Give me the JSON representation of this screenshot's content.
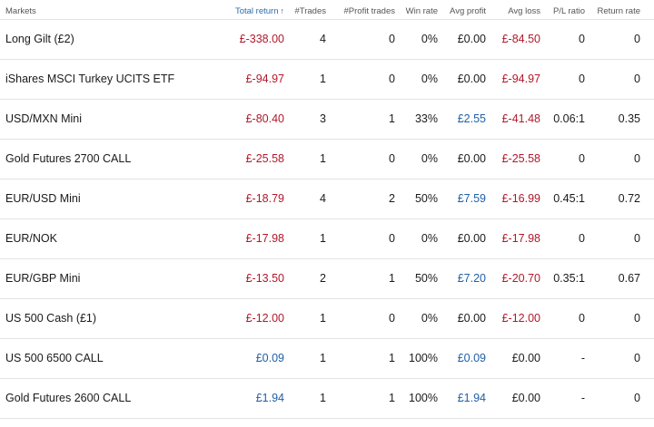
{
  "headers": {
    "markets": "Markets",
    "total_return": "Total return",
    "sort_indicator": "↑",
    "trades": "#Trades",
    "profit_trades": "#Profit trades",
    "win_rate": "Win rate",
    "avg_profit": "Avg profit",
    "avg_loss": "Avg loss",
    "pl_ratio": "P/L ratio",
    "return_rate": "Return rate"
  },
  "colors": {
    "negative": "#b2182b",
    "positive": "#1f5fa6",
    "sorted_header": "#2b6bb0"
  },
  "rows": [
    {
      "market": "Long Gilt (£2)",
      "total_return": "£-338.00",
      "total_sign": "neg",
      "trades": "4",
      "profit_trades": "0",
      "win_rate": "0%",
      "avg_profit": "£0.00",
      "avg_profit_sign": "neutral",
      "avg_loss": "£-84.50",
      "avg_loss_sign": "neg",
      "pl_ratio": "0",
      "return_rate": "0"
    },
    {
      "market": "iShares MSCI Turkey UCITS ETF",
      "total_return": "£-94.97",
      "total_sign": "neg",
      "trades": "1",
      "profit_trades": "0",
      "win_rate": "0%",
      "avg_profit": "£0.00",
      "avg_profit_sign": "neutral",
      "avg_loss": "£-94.97",
      "avg_loss_sign": "neg",
      "pl_ratio": "0",
      "return_rate": "0"
    },
    {
      "market": "USD/MXN Mini",
      "total_return": "£-80.40",
      "total_sign": "neg",
      "trades": "3",
      "profit_trades": "1",
      "win_rate": "33%",
      "avg_profit": "£2.55",
      "avg_profit_sign": "pos",
      "avg_loss": "£-41.48",
      "avg_loss_sign": "neg",
      "pl_ratio": "0.06:1",
      "return_rate": "0.35"
    },
    {
      "market": "Gold Futures 2700 CALL",
      "total_return": "£-25.58",
      "total_sign": "neg",
      "trades": "1",
      "profit_trades": "0",
      "win_rate": "0%",
      "avg_profit": "£0.00",
      "avg_profit_sign": "neutral",
      "avg_loss": "£-25.58",
      "avg_loss_sign": "neg",
      "pl_ratio": "0",
      "return_rate": "0"
    },
    {
      "market": "EUR/USD Mini",
      "total_return": "£-18.79",
      "total_sign": "neg",
      "trades": "4",
      "profit_trades": "2",
      "win_rate": "50%",
      "avg_profit": "£7.59",
      "avg_profit_sign": "pos",
      "avg_loss": "£-16.99",
      "avg_loss_sign": "neg",
      "pl_ratio": "0.45:1",
      "return_rate": "0.72"
    },
    {
      "market": "EUR/NOK",
      "total_return": "£-17.98",
      "total_sign": "neg",
      "trades": "1",
      "profit_trades": "0",
      "win_rate": "0%",
      "avg_profit": "£0.00",
      "avg_profit_sign": "neutral",
      "avg_loss": "£-17.98",
      "avg_loss_sign": "neg",
      "pl_ratio": "0",
      "return_rate": "0"
    },
    {
      "market": "EUR/GBP Mini",
      "total_return": "£-13.50",
      "total_sign": "neg",
      "trades": "2",
      "profit_trades": "1",
      "win_rate": "50%",
      "avg_profit": "£7.20",
      "avg_profit_sign": "pos",
      "avg_loss": "£-20.70",
      "avg_loss_sign": "neg",
      "pl_ratio": "0.35:1",
      "return_rate": "0.67"
    },
    {
      "market": "US 500 Cash (£1)",
      "total_return": "£-12.00",
      "total_sign": "neg",
      "trades": "1",
      "profit_trades": "0",
      "win_rate": "0%",
      "avg_profit": "£0.00",
      "avg_profit_sign": "neutral",
      "avg_loss": "£-12.00",
      "avg_loss_sign": "neg",
      "pl_ratio": "0",
      "return_rate": "0"
    },
    {
      "market": "US 500 6500 CALL",
      "total_return": "£0.09",
      "total_sign": "pos",
      "trades": "1",
      "profit_trades": "1",
      "win_rate": "100%",
      "avg_profit": "£0.09",
      "avg_profit_sign": "pos",
      "avg_loss": "£0.00",
      "avg_loss_sign": "neutral",
      "pl_ratio": "-",
      "return_rate": "0"
    },
    {
      "market": "Gold Futures 2600 CALL",
      "total_return": "£1.94",
      "total_sign": "pos",
      "trades": "1",
      "profit_trades": "1",
      "win_rate": "100%",
      "avg_profit": "£1.94",
      "avg_profit_sign": "pos",
      "avg_loss": "£0.00",
      "avg_loss_sign": "neutral",
      "pl_ratio": "-",
      "return_rate": "0"
    }
  ]
}
